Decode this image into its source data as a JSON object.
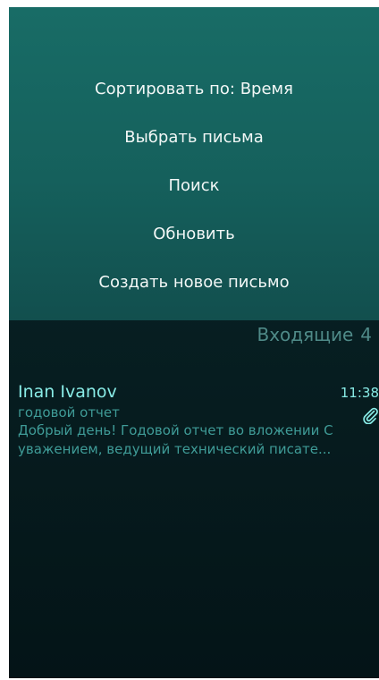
{
  "pulley_menu": {
    "items": [
      {
        "label": "Сортировать по: Время"
      },
      {
        "label": "Выбрать письма"
      },
      {
        "label": "Поиск"
      },
      {
        "label": "Обновить"
      },
      {
        "label": "Создать новое письмо"
      }
    ]
  },
  "header": {
    "title": "Входящие",
    "count": "4"
  },
  "messages": [
    {
      "sender": "Inan Ivanov",
      "time": "11:38",
      "subject": "годовой отчет",
      "preview_line1": "Добрый день! Годовой отчет во вложении С",
      "preview_line2": "уважением, ведущий технический писате...",
      "attachment_icon": "paperclip-icon"
    }
  ],
  "colors": {
    "accent": "#88ebe6",
    "secondary": "#3f9b97",
    "header": "#4f8a88",
    "pulley_bg": "#186c66"
  }
}
